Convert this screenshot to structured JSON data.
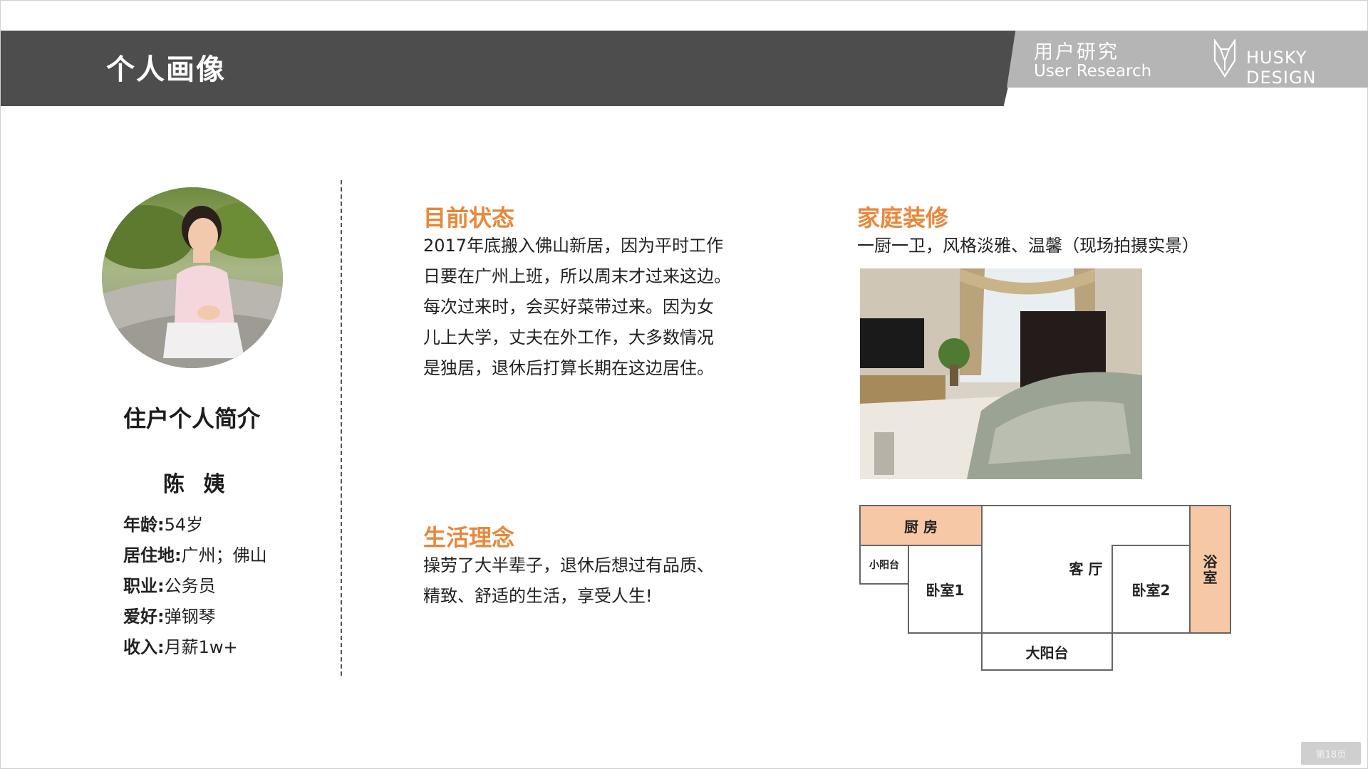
{
  "header": {
    "title": "个人画像",
    "section_cn": "用户研究",
    "section_en": "User Research",
    "brand": "HUSKY DESIGN"
  },
  "profile": {
    "heading": "住户个人简介",
    "name": "陈 姨",
    "rows": [
      {
        "label": "年龄:",
        "value": "54岁"
      },
      {
        "label": "居住地:",
        "value": "广州；佛山"
      },
      {
        "label": "职业:",
        "value": "公务员"
      },
      {
        "label": "爱好:",
        "value": "弹钢琴"
      },
      {
        "label": "收入:",
        "value": "月薪1w+"
      }
    ]
  },
  "status": {
    "title": "目前状态",
    "lines": [
      "2017年底搬入佛山新居，因为平时工作",
      "日要在广州上班，所以周末才过来这边。",
      "每次过来时，会买好菜带过来。因为女",
      "儿上大学，丈夫在外工作，大多数情况",
      "是独居，退休后打算长期在这边居住。"
    ]
  },
  "philosophy": {
    "title": "生活理念",
    "lines": [
      "操劳了大半辈子，退休后想过有品质、",
      "精致、舒适的生活，享受人生!"
    ]
  },
  "decoration": {
    "title": "家庭装修",
    "subtitle": "一厨一卫，风格淡雅、温馨（现场拍摄实景）"
  },
  "floorplan": {
    "kitchen": "厨 房",
    "small_balcony": "小阳台",
    "bedroom1": "卧室1",
    "living": "客 厅",
    "bedroom2": "卧室2",
    "bathroom": "浴\n室",
    "big_balcony": "大阳台"
  },
  "footer": {
    "page": "第18页"
  },
  "colors": {
    "header_dark": "#4d4d4d",
    "header_light": "#b5b5b5",
    "accent": "#e8873a",
    "room_highlight": "#f7c8a6"
  }
}
